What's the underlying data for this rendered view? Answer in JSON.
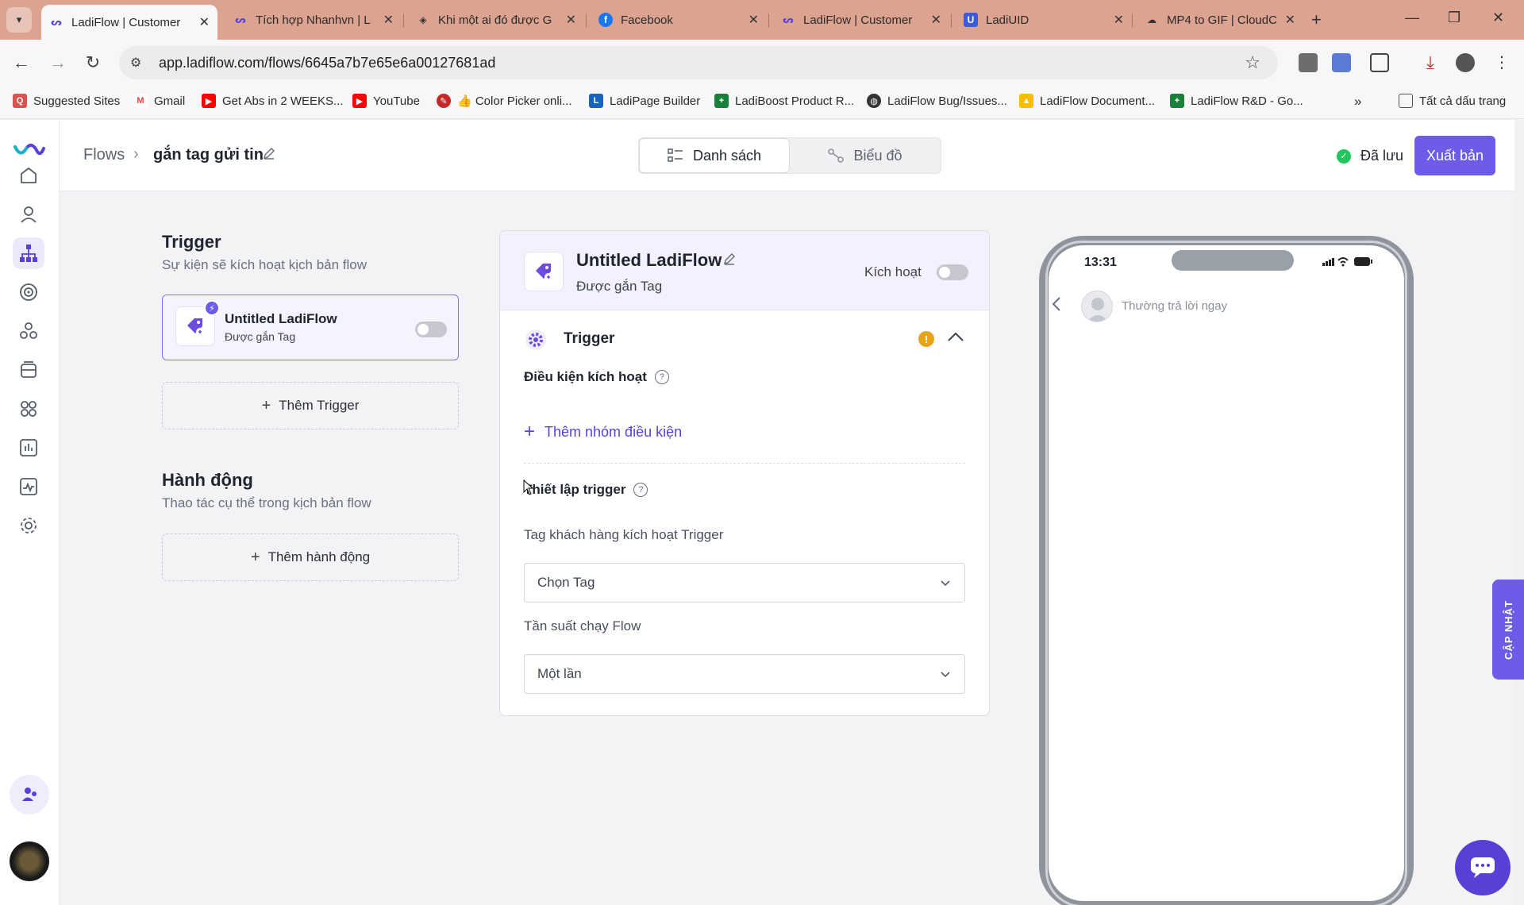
{
  "browser": {
    "tabs": [
      {
        "title": "LadiFlow | Customer",
        "icon": "ladiflow-icon",
        "active": true
      },
      {
        "title": "Tích hợp Nhanhvn | L",
        "icon": "ladiflow-icon",
        "active": false
      },
      {
        "title": "Khi một ai đó được G",
        "icon": "layers-icon",
        "active": false
      },
      {
        "title": "Facebook",
        "icon": "facebook-icon",
        "active": false
      },
      {
        "title": "LadiFlow | Customer",
        "icon": "ladiflow-icon",
        "active": false
      },
      {
        "title": "LadiUID",
        "icon": "ladiuid-icon",
        "active": false
      },
      {
        "title": "MP4 to GIF | CloudC",
        "icon": "cloud-icon",
        "active": false
      }
    ],
    "url": "app.ladiflow.com/flows/6645a7b7e65e6a00127681ad",
    "bookmarks": [
      {
        "label": "Suggested Sites",
        "icon": "suggested-icon",
        "color": "#d9534f"
      },
      {
        "label": "Gmail",
        "icon": "gmail-icon",
        "color": "#ea4335"
      },
      {
        "label": "Get Abs in 2 WEEKS...",
        "icon": "youtube-icon",
        "color": "#ff0000"
      },
      {
        "label": "YouTube",
        "icon": "youtube-icon",
        "color": "#ff0000"
      },
      {
        "label": "👍 Color Picker onli...",
        "icon": "color-picker-icon",
        "color": "#c62828"
      },
      {
        "label": "LadiPage Builder",
        "icon": "ladipage-icon",
        "color": "#1565c0"
      },
      {
        "label": "LadiBoost Product R...",
        "icon": "sheets-icon",
        "color": "#188038"
      },
      {
        "label": "LadiFlow Bug/Issues...",
        "icon": "globe-icon",
        "color": "#333333"
      },
      {
        "label": "LadiFlow Document...",
        "icon": "drive-icon",
        "color": "#fbbc04"
      },
      {
        "label": "LadiFlow R&D - Go...",
        "icon": "sheets-icon",
        "color": "#188038"
      }
    ],
    "all_bookmarks": "Tất cả dấu trang"
  },
  "header": {
    "breadcrumb_root": "Flows",
    "breadcrumb_current": "gắn tag gửi tin",
    "view_tabs": [
      {
        "label": "Danh sách",
        "active": true
      },
      {
        "label": "Biểu đồ",
        "active": false
      }
    ],
    "saved_label": "Đã lưu",
    "publish_label": "Xuất bản"
  },
  "left": {
    "trigger_title": "Trigger",
    "trigger_subtitle": "Sự kiện sẽ kích hoạt kịch bản flow",
    "trigger_card": {
      "title": "Untitled LadiFlow",
      "subtitle": "Được gắn Tag",
      "enabled": false
    },
    "add_trigger": "Thêm Trigger",
    "action_title": "Hành động",
    "action_subtitle": "Thao tác cụ thể trong kịch bản flow",
    "add_action": "Thêm hành động"
  },
  "panel": {
    "title": "Untitled LadiFlow",
    "subtitle": "Được gắn Tag",
    "active_label": "Kích hoạt",
    "section_title": "Trigger",
    "conditions_label": "Điều kiện kích hoạt",
    "add_condition_group": "Thêm nhóm điều kiện",
    "setup_label": "Thiết lập trigger",
    "tag_label": "Tag khách hàng kích hoạt Trigger",
    "tag_placeholder": "Chọn Tag",
    "frequency_label": "Tần suất chạy Flow",
    "frequency_value": "Một lần"
  },
  "phone": {
    "time": "13:31",
    "reply_status": "Thường trả lời ngay"
  },
  "update_tab": "CẬP NHẬT",
  "colors": {
    "brand": "#6c5ce7",
    "saved": "#22c55e",
    "warning": "#e8a31d"
  }
}
